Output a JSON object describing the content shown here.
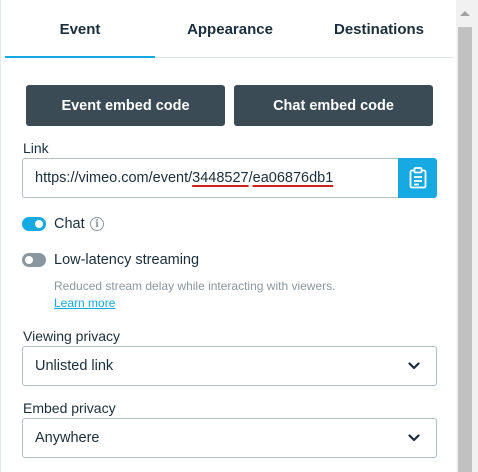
{
  "tabs": {
    "event": "Event",
    "appearance": "Appearance",
    "destinations": "Destinations",
    "active": "Event"
  },
  "buttons": {
    "event_embed": "Event embed code",
    "chat_embed": "Chat embed code"
  },
  "link": {
    "label": "Link",
    "prefix": "https://vimeo.com/event/",
    "event_id": "3448527",
    "separator": "/",
    "hash": "ea06876db1"
  },
  "chat": {
    "label": "Chat",
    "enabled": true,
    "info_icon": "i"
  },
  "latency": {
    "label": "Low-latency streaming",
    "enabled": false,
    "hint": "Reduced stream delay while interacting with viewers.",
    "learn_more": "Learn more"
  },
  "viewing_privacy": {
    "label": "Viewing privacy",
    "value": "Unlisted link"
  },
  "embed_privacy": {
    "label": "Embed privacy",
    "value": "Anywhere"
  },
  "colors": {
    "accent": "#17a9e1",
    "dark_button": "#3b4b55",
    "annotation": "#d0201a"
  }
}
